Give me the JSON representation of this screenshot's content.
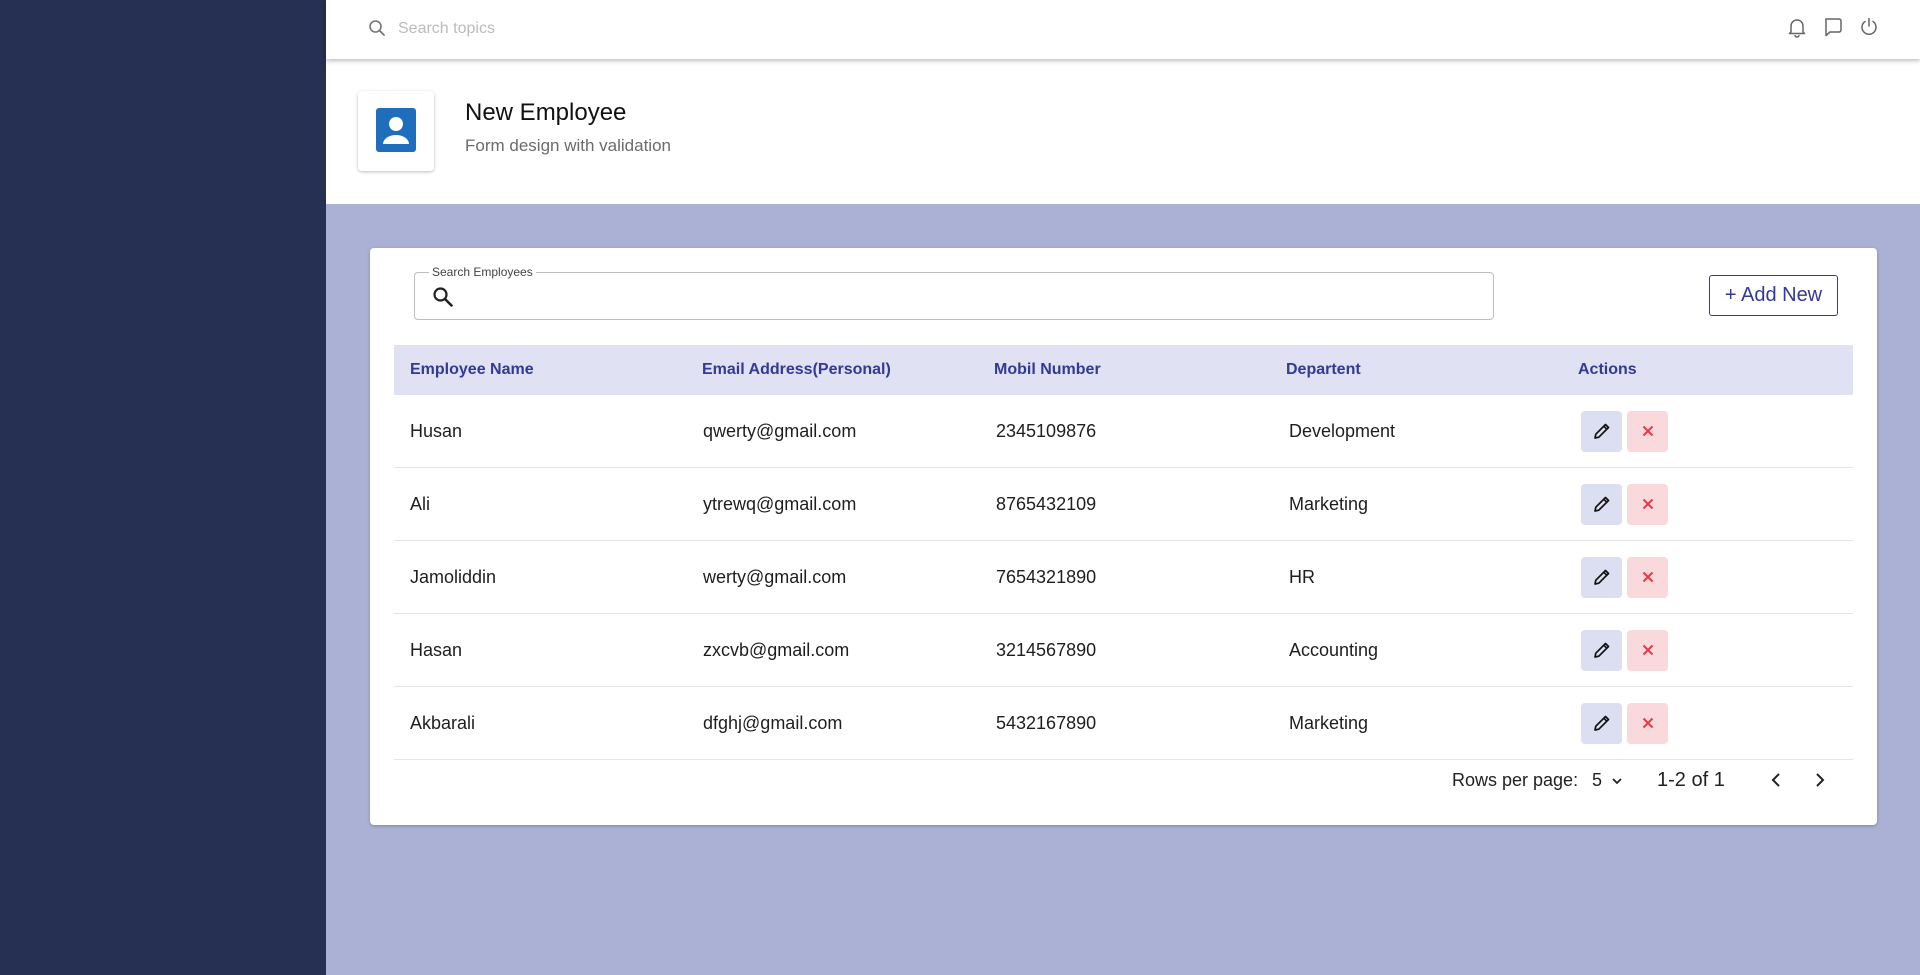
{
  "topbar": {
    "search_placeholder": "Search topics",
    "icons": [
      "bell-icon",
      "chat-icon",
      "power-icon"
    ]
  },
  "header": {
    "title": "New Employee",
    "subtitle": "Form design with validation",
    "icon": "person-icon"
  },
  "employees": {
    "search_label": "Search Employees",
    "search_value": "",
    "add_button": "+ Add New",
    "columns": [
      "Employee Name",
      "Email Address(Personal)",
      "Mobil Number",
      "Departent",
      "Actions"
    ],
    "rows": [
      {
        "name": "Husan",
        "email": "qwerty@gmail.com",
        "mobile": "2345109876",
        "department": "Development"
      },
      {
        "name": "Ali",
        "email": "ytrewq@gmail.com",
        "mobile": "8765432109",
        "department": "Marketing"
      },
      {
        "name": "Jamoliddin",
        "email": "werty@gmail.com",
        "mobile": "7654321890",
        "department": "HR"
      },
      {
        "name": "Hasan",
        "email": "zxcvb@gmail.com",
        "mobile": "3214567890",
        "department": "Accounting"
      },
      {
        "name": "Akbarali",
        "email": "dfghj@gmail.com",
        "mobile": "5432167890",
        "department": "Marketing"
      }
    ],
    "pagination": {
      "rows_per_page_label": "Rows per page:",
      "rows_per_page": "5",
      "range": "1-2 of 1"
    }
  },
  "colors": {
    "sidebar": "#253053",
    "background": "#aab1d4",
    "accent": "#333996",
    "header_icon": "#1f6dbd",
    "table_header": "#e0e1f3",
    "delete_red": "#e53946"
  }
}
